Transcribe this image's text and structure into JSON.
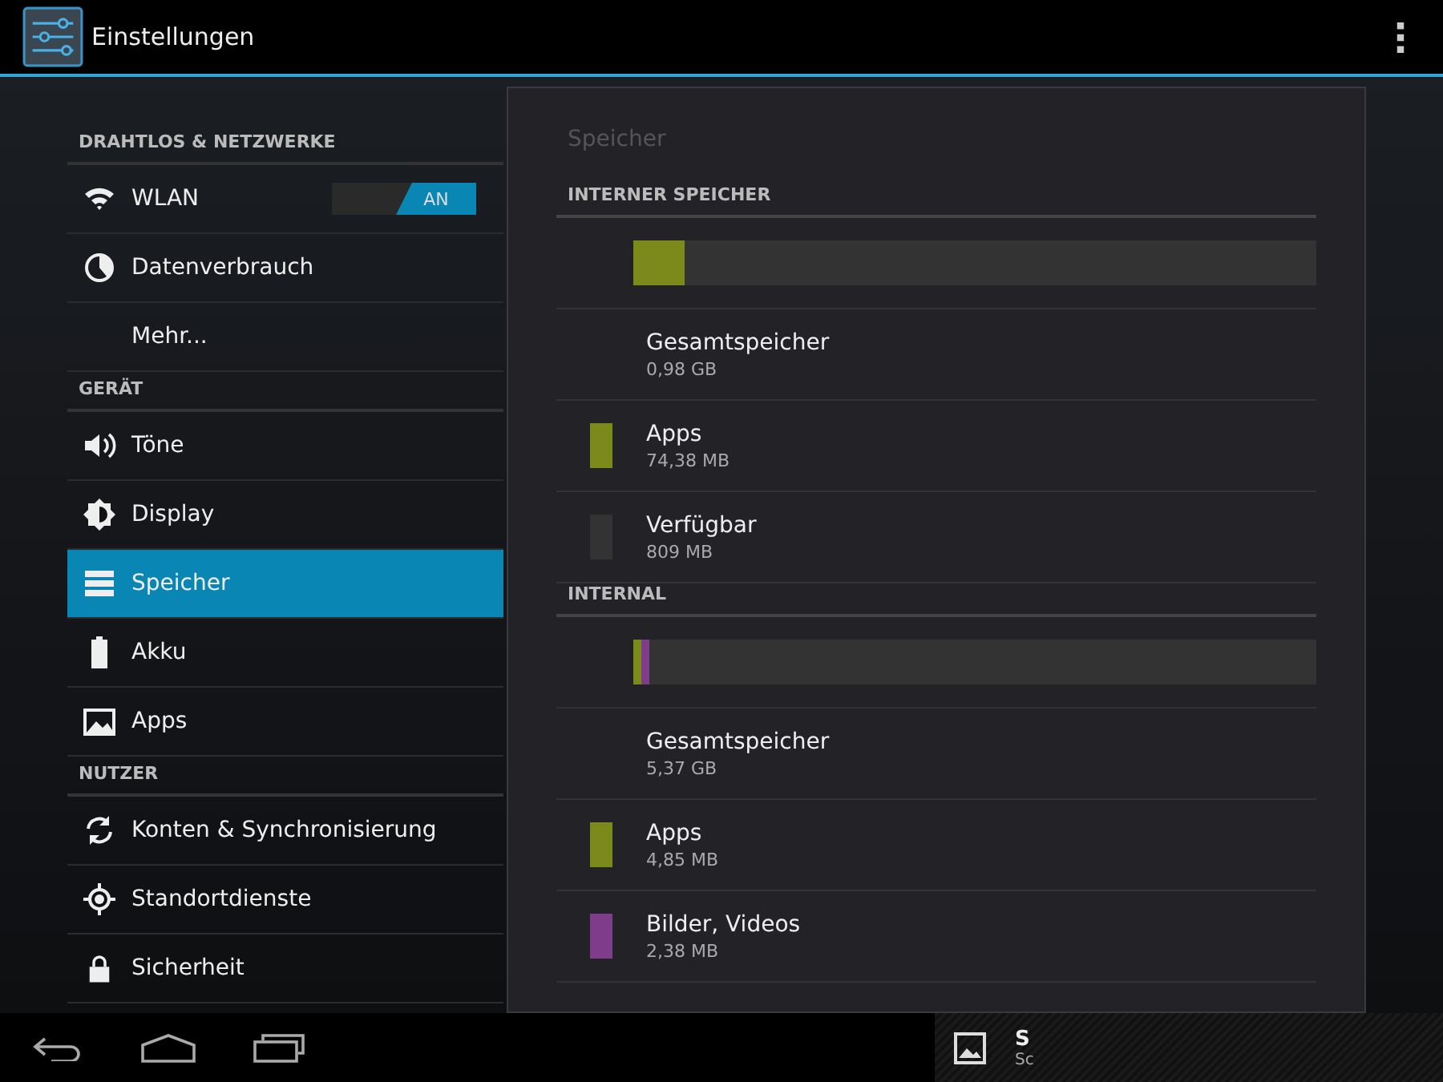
{
  "action_bar": {
    "title": "Einstellungen"
  },
  "sidebar": {
    "sections": [
      {
        "header": "DRAHTLOS & NETZWERKE",
        "items": [
          {
            "label": "WLAN",
            "kind": "wifi",
            "selected": false,
            "toggle": {
              "label": "AN",
              "on": true
            }
          },
          {
            "label": "Datenverbrauch",
            "kind": "data",
            "selected": false
          },
          {
            "label": "Mehr...",
            "kind": "plain",
            "selected": false
          }
        ]
      },
      {
        "header": "GERÄT",
        "items": [
          {
            "label": "Töne",
            "kind": "sound",
            "selected": false
          },
          {
            "label": "Display",
            "kind": "display",
            "selected": false
          },
          {
            "label": "Speicher",
            "kind": "storage",
            "selected": true
          },
          {
            "label": "Akku",
            "kind": "battery",
            "selected": false
          },
          {
            "label": "Apps",
            "kind": "apps",
            "selected": false
          }
        ]
      },
      {
        "header": "NUTZER",
        "items": [
          {
            "label": "Konten & Synchronisierung",
            "kind": "sync",
            "selected": false
          },
          {
            "label": "Standortdienste",
            "kind": "location",
            "selected": false
          },
          {
            "label": "Sicherheit",
            "kind": "lock",
            "selected": false
          }
        ]
      }
    ]
  },
  "detail": {
    "title": "Speicher",
    "groups": [
      {
        "header": "INTERNER SPEICHER",
        "bar": [
          {
            "color": "#7b8a1b",
            "level": 0.074
          }
        ],
        "items": [
          {
            "label": "Gesamtspeicher",
            "value": "0,98 GB"
          },
          {
            "label": "Apps",
            "value": "74,38 MB",
            "color": "#7b8a1b"
          },
          {
            "label": "Verfügbar",
            "value": "809 MB",
            "color": "#333333"
          }
        ]
      },
      {
        "header": "INTERNAL",
        "bar": [
          {
            "color": "#7b8a1b",
            "level": 0.012
          },
          {
            "color": "#7e3c8a",
            "level": 0.012
          }
        ],
        "items": [
          {
            "label": "Gesamtspeicher",
            "value": "5,37 GB"
          },
          {
            "label": "Apps",
            "value": "4,85 MB",
            "color": "#7b8a1b"
          },
          {
            "label": "Bilder, Videos",
            "value": "2,38 MB",
            "color": "#7e3c8a"
          }
        ]
      }
    ]
  },
  "notification": {
    "title": "S",
    "text": "Sc"
  }
}
